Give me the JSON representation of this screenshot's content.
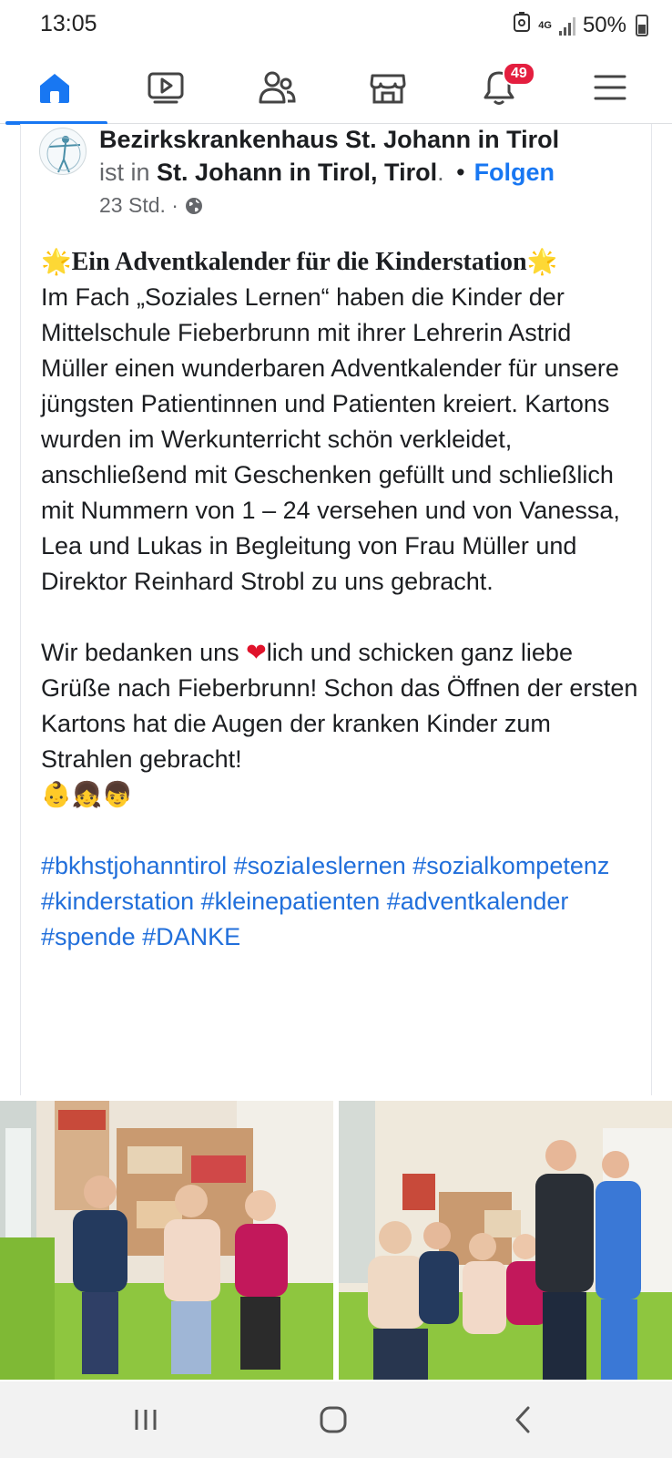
{
  "status": {
    "time": "13:05",
    "network": "4G",
    "battery": "50%"
  },
  "nav": {
    "notifications_badge": "49"
  },
  "post": {
    "author": "Bezirkskrankenhaus St. Johann in Tirol",
    "is_in": "ist in",
    "place": "St. Johann in Tirol, Tirol",
    "place_suffix": ".",
    "dot": "•",
    "follow": "Folgen",
    "time": "23 Std. ·",
    "headline_emoji": "🌟",
    "headline": "Ein Adventkalender für die Kinderstation",
    "para1": "Im Fach „Soziales Lernen“ haben die Kinder der Mittelschule Fieberbrunn mit ihrer Lehrerin Astrid Müller einen wunderbaren Adventkalender für unsere jüngsten Patientinnen und Patienten kreiert. Kartons wurden im Werkunterricht schön verkleidet, anschließend mit Geschenken gefüllt und schließlich mit Nummern von 1 – 24 versehen und von Vanessa, Lea und Lukas in Begleitung von Frau Müller und Direktor Reinhard Strobl zu uns gebracht.",
    "para2_before": "Wir bedanken uns ",
    "para2_heart": "❤",
    "para2_after": "lich und schicken ganz liebe Grüße nach Fieberbrunn! Schon das Öffnen der ersten Kartons hat die Augen der kranken Kinder zum Strahlen gebracht!",
    "emojis": "👶👧👦",
    "hashtags": "#bkhstjohanntirol #soziaIeslernen #sozialkompetenz #kinderstation #kleinepatienten #adventkalender #spende #DANKE"
  },
  "icons": {
    "home": "home-icon",
    "video": "video-icon",
    "friends": "friends-icon",
    "marketplace": "marketplace-icon",
    "notifications": "bell-icon",
    "menu": "menu-icon",
    "globe": "globe-icon"
  },
  "colors": {
    "accent": "#1877f2",
    "badge": "#e41e3f",
    "hashtag": "#216fdb"
  }
}
